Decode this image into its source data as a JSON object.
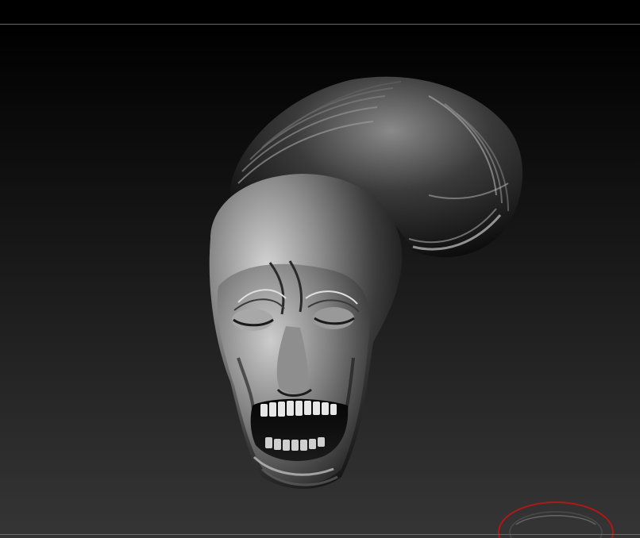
{
  "viewport": {
    "model_name": "sculpted-head-with-coiled-tail"
  },
  "colors": {
    "background_top": "#000000",
    "background_bottom": "#353535",
    "frame_line": "#6a6a6a",
    "gizmo_accent": "#b01818"
  },
  "icons": {
    "navigation_gizmo": "orbit-gizmo-icon"
  }
}
